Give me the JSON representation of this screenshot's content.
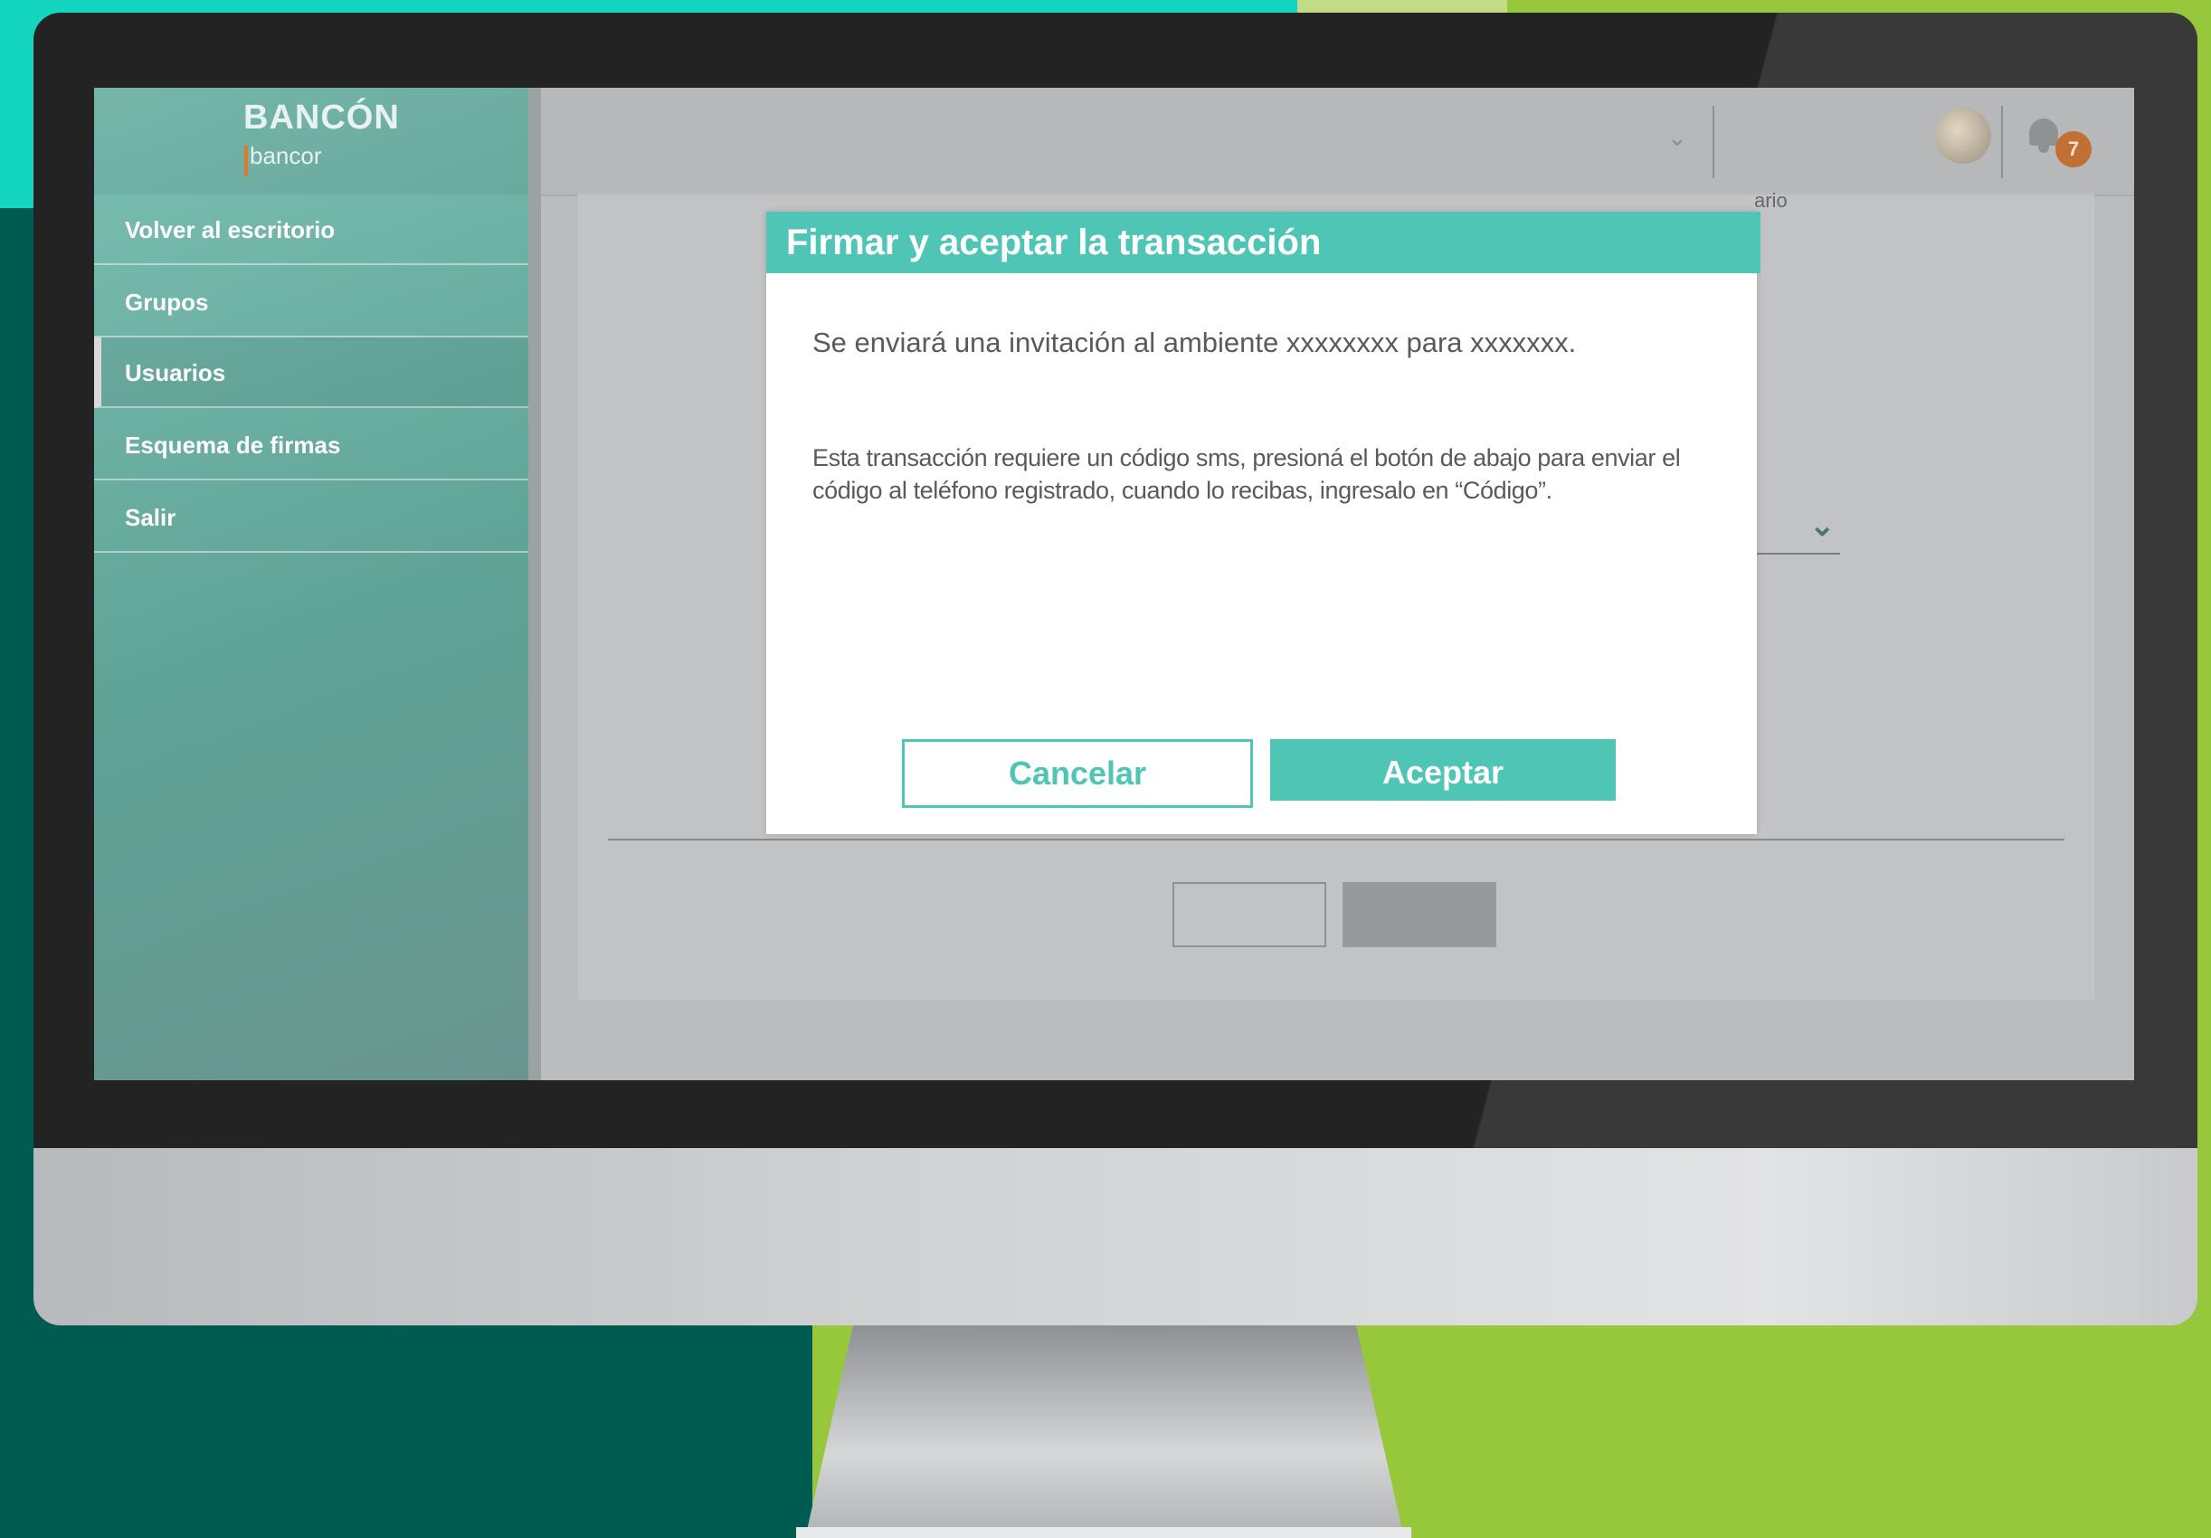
{
  "brand": {
    "name": "BANCÓN",
    "sub": "bancor"
  },
  "sidebar": {
    "items": [
      {
        "label": "Volver al escritorio"
      },
      {
        "label": "Grupos"
      },
      {
        "label": "Usuarios",
        "active": true
      },
      {
        "label": "Esquema de firmas"
      },
      {
        "label": "Salir"
      }
    ]
  },
  "topbar": {
    "notification_count": "7",
    "hint_text": "ario"
  },
  "modal": {
    "title": "Firmar y aceptar la transacción",
    "message": "Se enviará una invitación al ambiente xxxxxxxx para xxxxxxx.",
    "sms_notice": "Esta transacción requiere un código sms, presioná el botón de abajo para enviar el código al teléfono registrado, cuando lo recibas, ingresalo en “Código”.",
    "cancel_label": "Cancelar",
    "accept_label": "Aceptar"
  },
  "colors": {
    "accent": "#4ec5b5",
    "sidebar": "#5fa396",
    "badge": "#c26f34"
  },
  "icons": {
    "dropdown": "chevron-down-icon",
    "notifications": "bell-icon",
    "avatar": "avatar"
  }
}
